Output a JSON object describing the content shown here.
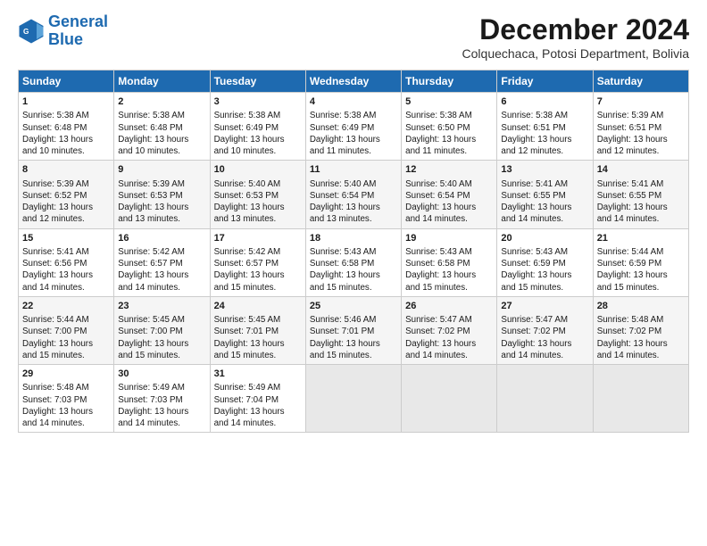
{
  "logo": {
    "line1": "General",
    "line2": "Blue"
  },
  "title": "December 2024",
  "subtitle": "Colquechaca, Potosi Department, Bolivia",
  "days_of_week": [
    "Sunday",
    "Monday",
    "Tuesday",
    "Wednesday",
    "Thursday",
    "Friday",
    "Saturday"
  ],
  "weeks": [
    [
      {
        "day": "1",
        "info": "Sunrise: 5:38 AM\nSunset: 6:48 PM\nDaylight: 13 hours\nand 10 minutes."
      },
      {
        "day": "2",
        "info": "Sunrise: 5:38 AM\nSunset: 6:48 PM\nDaylight: 13 hours\nand 10 minutes."
      },
      {
        "day": "3",
        "info": "Sunrise: 5:38 AM\nSunset: 6:49 PM\nDaylight: 13 hours\nand 10 minutes."
      },
      {
        "day": "4",
        "info": "Sunrise: 5:38 AM\nSunset: 6:49 PM\nDaylight: 13 hours\nand 11 minutes."
      },
      {
        "day": "5",
        "info": "Sunrise: 5:38 AM\nSunset: 6:50 PM\nDaylight: 13 hours\nand 11 minutes."
      },
      {
        "day": "6",
        "info": "Sunrise: 5:38 AM\nSunset: 6:51 PM\nDaylight: 13 hours\nand 12 minutes."
      },
      {
        "day": "7",
        "info": "Sunrise: 5:39 AM\nSunset: 6:51 PM\nDaylight: 13 hours\nand 12 minutes."
      }
    ],
    [
      {
        "day": "8",
        "info": "Sunrise: 5:39 AM\nSunset: 6:52 PM\nDaylight: 13 hours\nand 12 minutes."
      },
      {
        "day": "9",
        "info": "Sunrise: 5:39 AM\nSunset: 6:53 PM\nDaylight: 13 hours\nand 13 minutes."
      },
      {
        "day": "10",
        "info": "Sunrise: 5:40 AM\nSunset: 6:53 PM\nDaylight: 13 hours\nand 13 minutes."
      },
      {
        "day": "11",
        "info": "Sunrise: 5:40 AM\nSunset: 6:54 PM\nDaylight: 13 hours\nand 13 minutes."
      },
      {
        "day": "12",
        "info": "Sunrise: 5:40 AM\nSunset: 6:54 PM\nDaylight: 13 hours\nand 14 minutes."
      },
      {
        "day": "13",
        "info": "Sunrise: 5:41 AM\nSunset: 6:55 PM\nDaylight: 13 hours\nand 14 minutes."
      },
      {
        "day": "14",
        "info": "Sunrise: 5:41 AM\nSunset: 6:55 PM\nDaylight: 13 hours\nand 14 minutes."
      }
    ],
    [
      {
        "day": "15",
        "info": "Sunrise: 5:41 AM\nSunset: 6:56 PM\nDaylight: 13 hours\nand 14 minutes."
      },
      {
        "day": "16",
        "info": "Sunrise: 5:42 AM\nSunset: 6:57 PM\nDaylight: 13 hours\nand 14 minutes."
      },
      {
        "day": "17",
        "info": "Sunrise: 5:42 AM\nSunset: 6:57 PM\nDaylight: 13 hours\nand 15 minutes."
      },
      {
        "day": "18",
        "info": "Sunrise: 5:43 AM\nSunset: 6:58 PM\nDaylight: 13 hours\nand 15 minutes."
      },
      {
        "day": "19",
        "info": "Sunrise: 5:43 AM\nSunset: 6:58 PM\nDaylight: 13 hours\nand 15 minutes."
      },
      {
        "day": "20",
        "info": "Sunrise: 5:43 AM\nSunset: 6:59 PM\nDaylight: 13 hours\nand 15 minutes."
      },
      {
        "day": "21",
        "info": "Sunrise: 5:44 AM\nSunset: 6:59 PM\nDaylight: 13 hours\nand 15 minutes."
      }
    ],
    [
      {
        "day": "22",
        "info": "Sunrise: 5:44 AM\nSunset: 7:00 PM\nDaylight: 13 hours\nand 15 minutes."
      },
      {
        "day": "23",
        "info": "Sunrise: 5:45 AM\nSunset: 7:00 PM\nDaylight: 13 hours\nand 15 minutes."
      },
      {
        "day": "24",
        "info": "Sunrise: 5:45 AM\nSunset: 7:01 PM\nDaylight: 13 hours\nand 15 minutes."
      },
      {
        "day": "25",
        "info": "Sunrise: 5:46 AM\nSunset: 7:01 PM\nDaylight: 13 hours\nand 15 minutes."
      },
      {
        "day": "26",
        "info": "Sunrise: 5:47 AM\nSunset: 7:02 PM\nDaylight: 13 hours\nand 14 minutes."
      },
      {
        "day": "27",
        "info": "Sunrise: 5:47 AM\nSunset: 7:02 PM\nDaylight: 13 hours\nand 14 minutes."
      },
      {
        "day": "28",
        "info": "Sunrise: 5:48 AM\nSunset: 7:02 PM\nDaylight: 13 hours\nand 14 minutes."
      }
    ],
    [
      {
        "day": "29",
        "info": "Sunrise: 5:48 AM\nSunset: 7:03 PM\nDaylight: 13 hours\nand 14 minutes."
      },
      {
        "day": "30",
        "info": "Sunrise: 5:49 AM\nSunset: 7:03 PM\nDaylight: 13 hours\nand 14 minutes."
      },
      {
        "day": "31",
        "info": "Sunrise: 5:49 AM\nSunset: 7:04 PM\nDaylight: 13 hours\nand 14 minutes."
      },
      {
        "day": "",
        "info": ""
      },
      {
        "day": "",
        "info": ""
      },
      {
        "day": "",
        "info": ""
      },
      {
        "day": "",
        "info": ""
      }
    ]
  ]
}
